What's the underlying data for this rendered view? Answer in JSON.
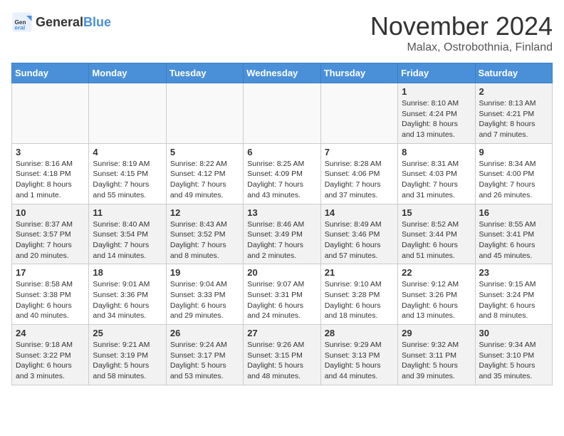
{
  "header": {
    "logo_general": "General",
    "logo_blue": "Blue",
    "month": "November 2024",
    "location": "Malax, Ostrobothnia, Finland"
  },
  "days_of_week": [
    "Sunday",
    "Monday",
    "Tuesday",
    "Wednesday",
    "Thursday",
    "Friday",
    "Saturday"
  ],
  "weeks": [
    [
      {
        "day": "",
        "info": ""
      },
      {
        "day": "",
        "info": ""
      },
      {
        "day": "",
        "info": ""
      },
      {
        "day": "",
        "info": ""
      },
      {
        "day": "",
        "info": ""
      },
      {
        "day": "1",
        "info": "Sunrise: 8:10 AM\nSunset: 4:24 PM\nDaylight: 8 hours and 13 minutes."
      },
      {
        "day": "2",
        "info": "Sunrise: 8:13 AM\nSunset: 4:21 PM\nDaylight: 8 hours and 7 minutes."
      }
    ],
    [
      {
        "day": "3",
        "info": "Sunrise: 8:16 AM\nSunset: 4:18 PM\nDaylight: 8 hours and 1 minute."
      },
      {
        "day": "4",
        "info": "Sunrise: 8:19 AM\nSunset: 4:15 PM\nDaylight: 7 hours and 55 minutes."
      },
      {
        "day": "5",
        "info": "Sunrise: 8:22 AM\nSunset: 4:12 PM\nDaylight: 7 hours and 49 minutes."
      },
      {
        "day": "6",
        "info": "Sunrise: 8:25 AM\nSunset: 4:09 PM\nDaylight: 7 hours and 43 minutes."
      },
      {
        "day": "7",
        "info": "Sunrise: 8:28 AM\nSunset: 4:06 PM\nDaylight: 7 hours and 37 minutes."
      },
      {
        "day": "8",
        "info": "Sunrise: 8:31 AM\nSunset: 4:03 PM\nDaylight: 7 hours and 31 minutes."
      },
      {
        "day": "9",
        "info": "Sunrise: 8:34 AM\nSunset: 4:00 PM\nDaylight: 7 hours and 26 minutes."
      }
    ],
    [
      {
        "day": "10",
        "info": "Sunrise: 8:37 AM\nSunset: 3:57 PM\nDaylight: 7 hours and 20 minutes."
      },
      {
        "day": "11",
        "info": "Sunrise: 8:40 AM\nSunset: 3:54 PM\nDaylight: 7 hours and 14 minutes."
      },
      {
        "day": "12",
        "info": "Sunrise: 8:43 AM\nSunset: 3:52 PM\nDaylight: 7 hours and 8 minutes."
      },
      {
        "day": "13",
        "info": "Sunrise: 8:46 AM\nSunset: 3:49 PM\nDaylight: 7 hours and 2 minutes."
      },
      {
        "day": "14",
        "info": "Sunrise: 8:49 AM\nSunset: 3:46 PM\nDaylight: 6 hours and 57 minutes."
      },
      {
        "day": "15",
        "info": "Sunrise: 8:52 AM\nSunset: 3:44 PM\nDaylight: 6 hours and 51 minutes."
      },
      {
        "day": "16",
        "info": "Sunrise: 8:55 AM\nSunset: 3:41 PM\nDaylight: 6 hours and 45 minutes."
      }
    ],
    [
      {
        "day": "17",
        "info": "Sunrise: 8:58 AM\nSunset: 3:38 PM\nDaylight: 6 hours and 40 minutes."
      },
      {
        "day": "18",
        "info": "Sunrise: 9:01 AM\nSunset: 3:36 PM\nDaylight: 6 hours and 34 minutes."
      },
      {
        "day": "19",
        "info": "Sunrise: 9:04 AM\nSunset: 3:33 PM\nDaylight: 6 hours and 29 minutes."
      },
      {
        "day": "20",
        "info": "Sunrise: 9:07 AM\nSunset: 3:31 PM\nDaylight: 6 hours and 24 minutes."
      },
      {
        "day": "21",
        "info": "Sunrise: 9:10 AM\nSunset: 3:28 PM\nDaylight: 6 hours and 18 minutes."
      },
      {
        "day": "22",
        "info": "Sunrise: 9:12 AM\nSunset: 3:26 PM\nDaylight: 6 hours and 13 minutes."
      },
      {
        "day": "23",
        "info": "Sunrise: 9:15 AM\nSunset: 3:24 PM\nDaylight: 6 hours and 8 minutes."
      }
    ],
    [
      {
        "day": "24",
        "info": "Sunrise: 9:18 AM\nSunset: 3:22 PM\nDaylight: 6 hours and 3 minutes."
      },
      {
        "day": "25",
        "info": "Sunrise: 9:21 AM\nSunset: 3:19 PM\nDaylight: 5 hours and 58 minutes."
      },
      {
        "day": "26",
        "info": "Sunrise: 9:24 AM\nSunset: 3:17 PM\nDaylight: 5 hours and 53 minutes."
      },
      {
        "day": "27",
        "info": "Sunrise: 9:26 AM\nSunset: 3:15 PM\nDaylight: 5 hours and 48 minutes."
      },
      {
        "day": "28",
        "info": "Sunrise: 9:29 AM\nSunset: 3:13 PM\nDaylight: 5 hours and 44 minutes."
      },
      {
        "day": "29",
        "info": "Sunrise: 9:32 AM\nSunset: 3:11 PM\nDaylight: 5 hours and 39 minutes."
      },
      {
        "day": "30",
        "info": "Sunrise: 9:34 AM\nSunset: 3:10 PM\nDaylight: 5 hours and 35 minutes."
      }
    ]
  ]
}
